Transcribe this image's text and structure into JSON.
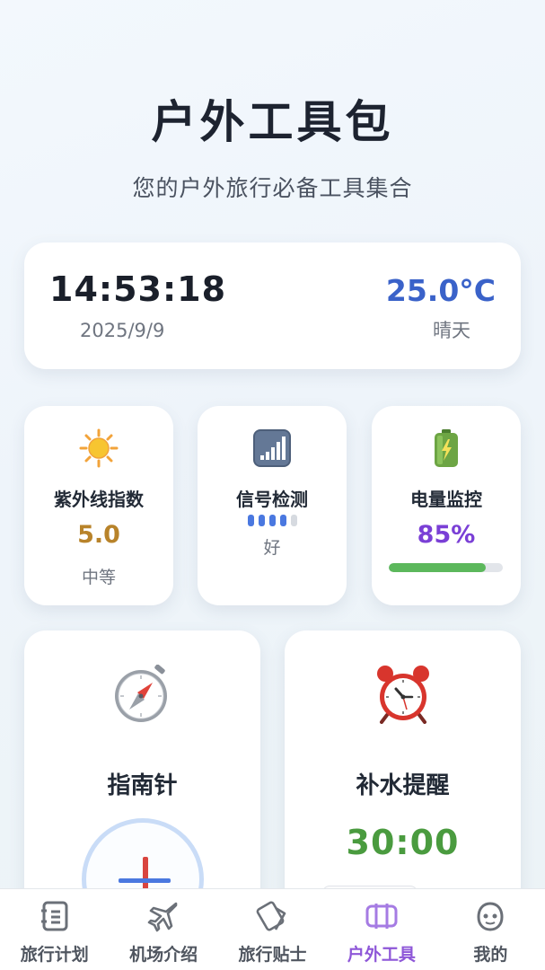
{
  "header": {
    "title": "户外工具包",
    "subtitle": "您的户外旅行必备工具集合"
  },
  "status": {
    "time": "14:53:18",
    "date": "2025/9/9",
    "temperature": "25.0°C",
    "weather": "晴天"
  },
  "uv": {
    "icon": "sun-icon",
    "label": "紫外线指数",
    "value": "5.0",
    "level": "中等"
  },
  "signal": {
    "icon": "signal-bars-icon",
    "label": "信号检测",
    "strength_bars": 4,
    "strength_max": 5,
    "quality": "好"
  },
  "battery": {
    "icon": "battery-icon",
    "label": "电量监控",
    "value": "85%",
    "level_fraction": 0.85
  },
  "compass": {
    "icon": "compass-icon",
    "label": "指南针"
  },
  "hydration": {
    "icon": "alarm-clock-icon",
    "label": "补水提醒",
    "timer": "30:00"
  },
  "tabs": [
    {
      "label": "旅行计划",
      "icon": "notebook-icon",
      "active": false
    },
    {
      "label": "机场介绍",
      "icon": "airplane-icon",
      "active": false
    },
    {
      "label": "旅行贴士",
      "icon": "cards-icon",
      "active": false
    },
    {
      "label": "户外工具",
      "icon": "toolkit-icon",
      "active": true
    },
    {
      "label": "我的",
      "icon": "face-icon",
      "active": false
    }
  ],
  "colors": {
    "accent": "#8e57d8",
    "temperature": "#3a62c9",
    "uv_value": "#b8832a",
    "battery_value": "#7a3fd6",
    "battery_fill": "#5cb85c",
    "timer": "#4a9b3f"
  }
}
